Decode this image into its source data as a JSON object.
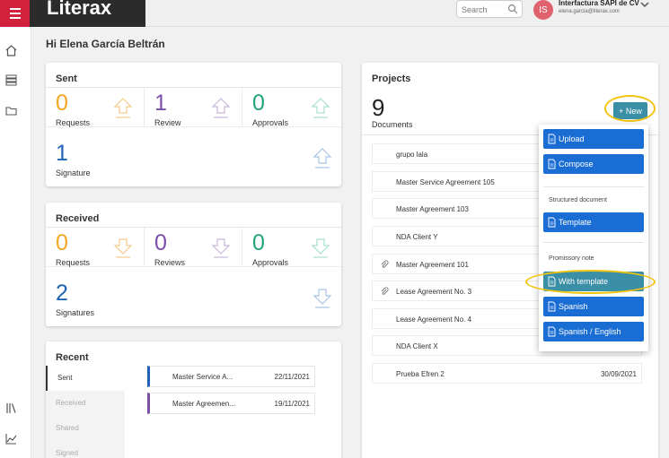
{
  "header": {
    "brand": "Literax",
    "search_placeholder": "Search",
    "avatar_initials": "IS",
    "company": "Interfactura SAPI de CV",
    "email": "elena.garcia@literax.com"
  },
  "greeting": "Hi Elena García Beltrán",
  "sent": {
    "title": "Sent",
    "stats": [
      {
        "value": "0",
        "label": "Requests"
      },
      {
        "value": "1",
        "label": "Review"
      },
      {
        "value": "0",
        "label": "Approvals"
      },
      {
        "value": "1",
        "label": "Signature"
      }
    ]
  },
  "received": {
    "title": "Received",
    "stats": [
      {
        "value": "0",
        "label": "Requests"
      },
      {
        "value": "0",
        "label": "Reviews"
      },
      {
        "value": "0",
        "label": "Approvals"
      },
      {
        "value": "2",
        "label": "Signatures"
      }
    ]
  },
  "recent": {
    "title": "Recent",
    "tabs": [
      "Sent",
      "Received",
      "Shared",
      "Signed"
    ],
    "rows": [
      {
        "name": "Master Service A...",
        "date": "22/11/2021"
      },
      {
        "name": "Master Agreemen...",
        "date": "19/11/2021"
      }
    ]
  },
  "projects": {
    "title": "Projects",
    "count": "9",
    "count_label": "Documents",
    "new_label": "+ New",
    "rows": [
      {
        "name": "grupo lala",
        "date": ""
      },
      {
        "name": "Master Service Agreement 105",
        "date": ""
      },
      {
        "name": "Master Agreement 103",
        "date": ""
      },
      {
        "name": "NDA Client Y",
        "date": ""
      },
      {
        "name": "Master Agreement 101",
        "date": ""
      },
      {
        "name": "Lease Agreement No. 3",
        "date": ""
      },
      {
        "name": "Lease Agreement No. 4",
        "date": ""
      },
      {
        "name": "NDA Client X",
        "date": ""
      },
      {
        "name": "Prueba Efren 2",
        "date": "30/09/2021"
      }
    ]
  },
  "new_menu": {
    "upload": "Upload",
    "compose": "Compose",
    "structured_label": "Structured document",
    "template": "Template",
    "promissory_label": "Promissory note",
    "with_template": "With template",
    "spanish": "Spanish",
    "spanish_english": "Spanish / English"
  },
  "colors": {
    "brand_red": "#d1213d",
    "requests": "#f5a623",
    "review": "#7b4fa8",
    "approvals": "#21a67a",
    "signature": "#1f63b5",
    "menu_blue": "#1a6dd3",
    "teal": "#3a8fa6",
    "highlight": "#f1c40f"
  }
}
